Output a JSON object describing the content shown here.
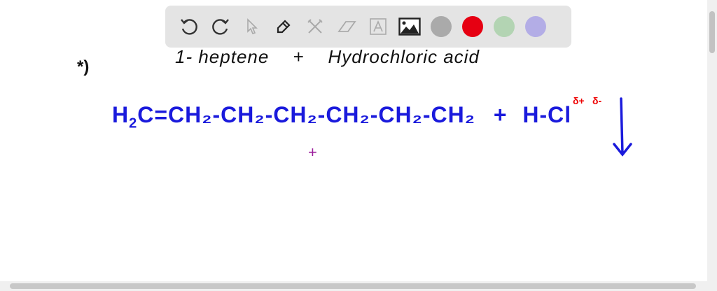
{
  "toolbar": {
    "tools": [
      "undo-icon",
      "redo-icon",
      "select-icon",
      "pen-icon",
      "tools-icon",
      "eraser-icon",
      "text-icon",
      "image-icon"
    ],
    "colors": [
      "#aaaaaa",
      "#e60012",
      "#b3d4b3",
      "#b3ade6"
    ]
  },
  "board": {
    "marker": "*)",
    "title_left": "1- heptene",
    "title_plus": "+",
    "title_right": "Hydrochloric acid",
    "formula": {
      "h2c": "H",
      "h2c_sub": "2",
      "h2c_c": "C",
      "chain": "=CH₂-CH₂-CH₂-CH₂-CH₂-CH₂",
      "plus": "+",
      "hcl": "H-Cl"
    },
    "delta_plus": "δ+",
    "delta_minus": "δ-",
    "cursor": "+"
  },
  "colors": {
    "ink_blue": "#1a1adc",
    "ink_red": "#e00000",
    "ink_black": "#111111"
  }
}
